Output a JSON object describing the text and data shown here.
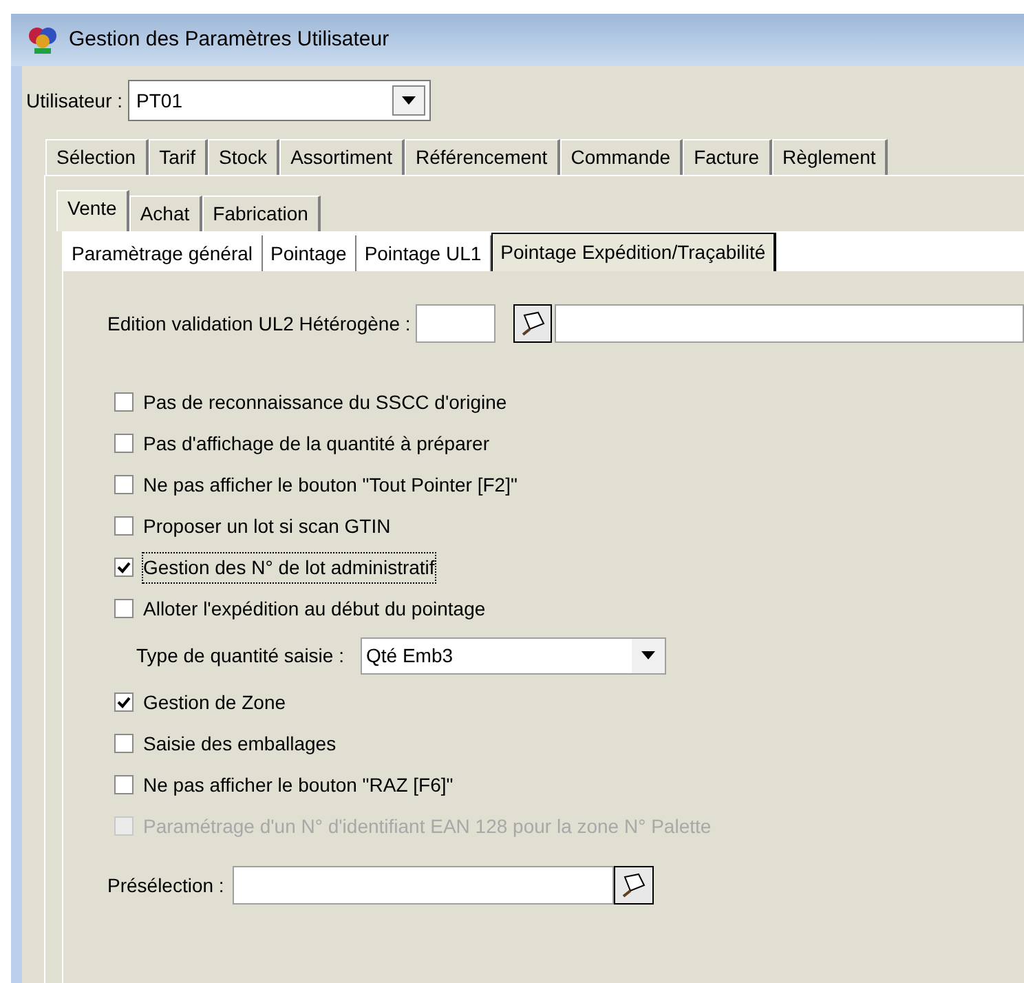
{
  "window": {
    "title": "Gestion des Paramètres Utilisateur"
  },
  "user": {
    "label": "Utilisateur :",
    "value": "PT01"
  },
  "tabs_main": [
    {
      "label": "Sélection",
      "selected": false
    },
    {
      "label": "Tarif",
      "selected": false
    },
    {
      "label": "Stock",
      "selected": false
    },
    {
      "label": "Assortiment",
      "selected": false
    },
    {
      "label": "Référencement",
      "selected": false
    },
    {
      "label": "Commande",
      "selected": false
    },
    {
      "label": "Facture",
      "selected": false
    },
    {
      "label": "Règlement",
      "selected": false
    }
  ],
  "tabs_sub": [
    {
      "label": "Vente",
      "selected": true
    },
    {
      "label": "Achat",
      "selected": false
    },
    {
      "label": "Fabrication",
      "selected": false
    }
  ],
  "tabs_section": [
    {
      "label": "Paramètrage général",
      "selected": false
    },
    {
      "label": "Pointage",
      "selected": false
    },
    {
      "label": "Pointage UL1",
      "selected": false
    },
    {
      "label": "Pointage Expédition/Traçabilité",
      "selected": true
    }
  ],
  "edition": {
    "label": "Edition validation UL2 Hétérogène :"
  },
  "options": [
    {
      "kind": "checkbox",
      "label": "Pas de reconnaissance du SSCC d'origine",
      "checked": false,
      "disabled": false,
      "focused": false
    },
    {
      "kind": "checkbox",
      "label": "Pas d'affichage de la quantité à préparer",
      "checked": false,
      "disabled": false,
      "focused": false
    },
    {
      "kind": "checkbox",
      "label": "Ne pas afficher le bouton \"Tout Pointer [F2]\"",
      "checked": false,
      "disabled": false,
      "focused": false
    },
    {
      "kind": "checkbox",
      "label": "Proposer un lot si scan GTIN",
      "checked": false,
      "disabled": false,
      "focused": false
    },
    {
      "kind": "checkbox",
      "label": "Gestion des N° de lot administratif",
      "checked": true,
      "disabled": false,
      "focused": true
    },
    {
      "kind": "checkbox",
      "label": "Alloter l'expédition au début du pointage",
      "checked": false,
      "disabled": false,
      "focused": false
    },
    {
      "kind": "select",
      "label": "Type de quantité saisie :",
      "value": "Qté Emb3"
    },
    {
      "kind": "checkbox",
      "label": "Gestion de Zone",
      "checked": true,
      "disabled": false,
      "focused": false
    },
    {
      "kind": "checkbox",
      "label": "Saisie des emballages",
      "checked": false,
      "disabled": false,
      "focused": false
    },
    {
      "kind": "checkbox",
      "label": "Ne pas afficher le bouton \"RAZ [F6]\"",
      "checked": false,
      "disabled": false,
      "focused": false
    },
    {
      "kind": "checkbox",
      "label": "Paramétrage d'un N° d'identifiant EAN 128 pour la zone N° Palette",
      "checked": false,
      "disabled": true,
      "focused": false
    }
  ],
  "preselection": {
    "label": "Présélection :"
  }
}
